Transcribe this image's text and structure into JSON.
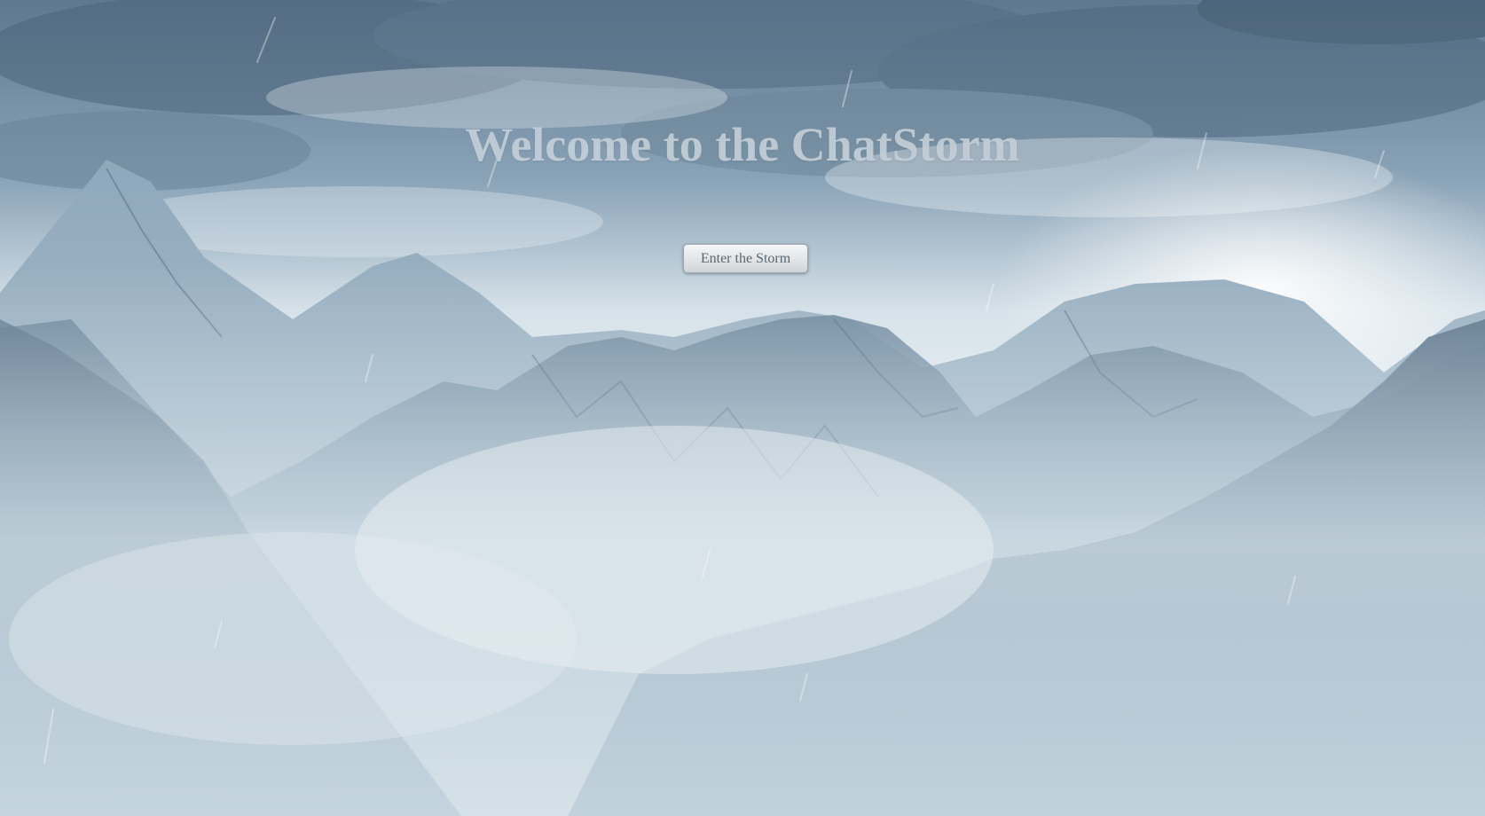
{
  "page": {
    "title": "Welcome to the ChatStorm",
    "cta_label": "Enter the Storm"
  },
  "background": {
    "scene": "snowy-mountain-storm",
    "sky_color": "#6f879c",
    "haze_color": "#dbe6ec",
    "mountain_color": "#7f98ad"
  }
}
